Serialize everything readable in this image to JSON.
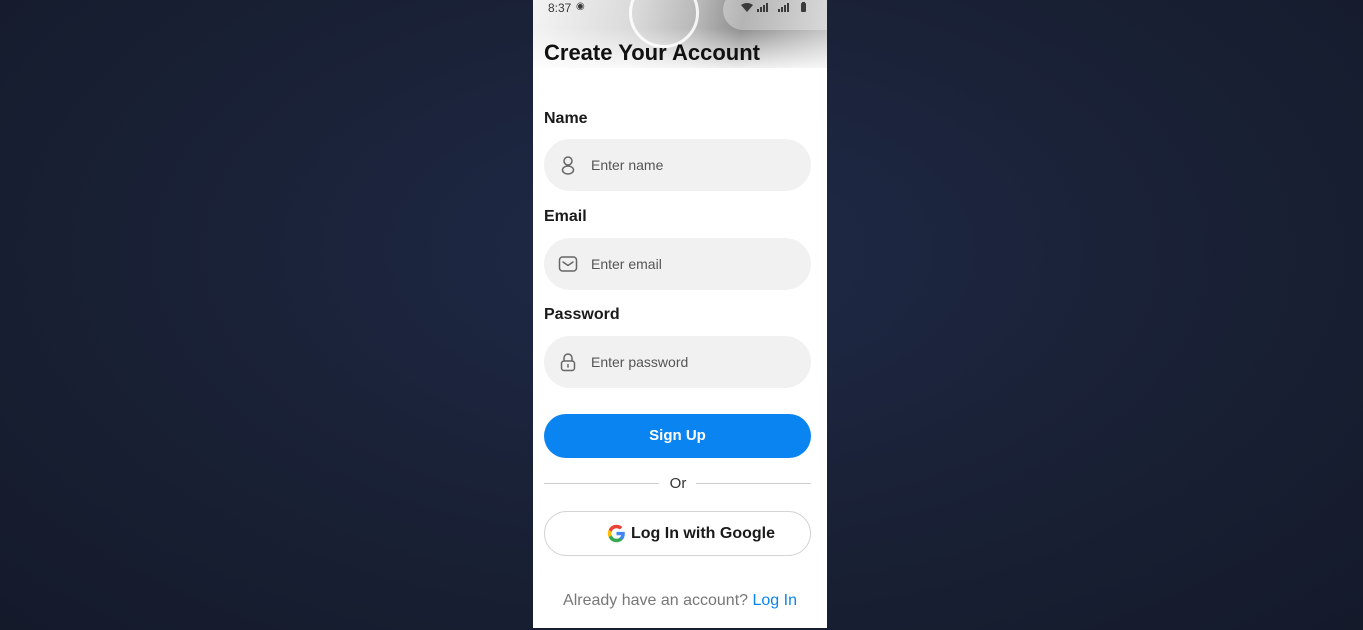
{
  "status_bar": {
    "time": "8:37",
    "icons": "wifi-icon signal-icon battery-icon"
  },
  "page": {
    "title": "Create Your Account"
  },
  "form": {
    "name_label": "Name",
    "name_placeholder": "Enter name",
    "email_label": "Email",
    "email_placeholder": "Enter email",
    "password_label": "Password",
    "password_placeholder": "Enter password",
    "signup_label": "Sign Up",
    "or_text": "Or",
    "google_label": "Log In with Google"
  },
  "footer": {
    "prompt": "Already have an account?",
    "login_link": "Log In"
  },
  "colors": {
    "accent": "#0a84f0",
    "field_bg": "#f1f1f1",
    "backdrop": "#1a2238"
  }
}
